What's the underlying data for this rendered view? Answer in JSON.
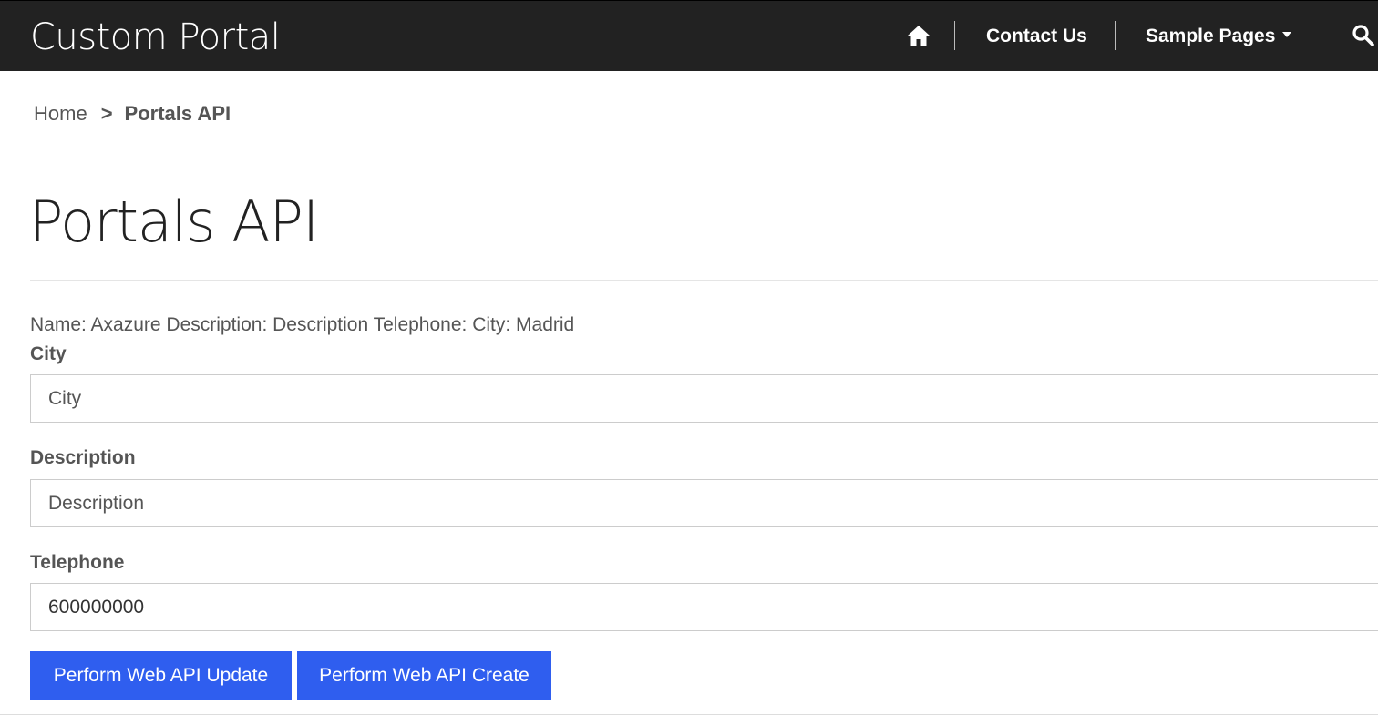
{
  "navbar": {
    "brand": "Custom Portal",
    "home_icon": "home-icon",
    "links": [
      {
        "label": "Contact Us"
      },
      {
        "label": "Sample Pages",
        "has_dropdown": true
      }
    ],
    "search_icon": "search-icon"
  },
  "breadcrumb": {
    "home": "Home",
    "separator": ">",
    "current": "Portals API"
  },
  "page": {
    "title": "Portals API",
    "summary": "Name: Axazure Description: Description Telephone: City: Madrid"
  },
  "form": {
    "city": {
      "label": "City",
      "placeholder": "City",
      "value": ""
    },
    "description": {
      "label": "Description",
      "placeholder": "Description",
      "value": ""
    },
    "telephone": {
      "label": "Telephone",
      "placeholder": "",
      "value": "600000000"
    }
  },
  "buttons": {
    "update": "Perform Web API Update",
    "create": "Perform Web API Create"
  },
  "colors": {
    "navbar_bg": "#222222",
    "button_bg": "#2f5eef"
  }
}
